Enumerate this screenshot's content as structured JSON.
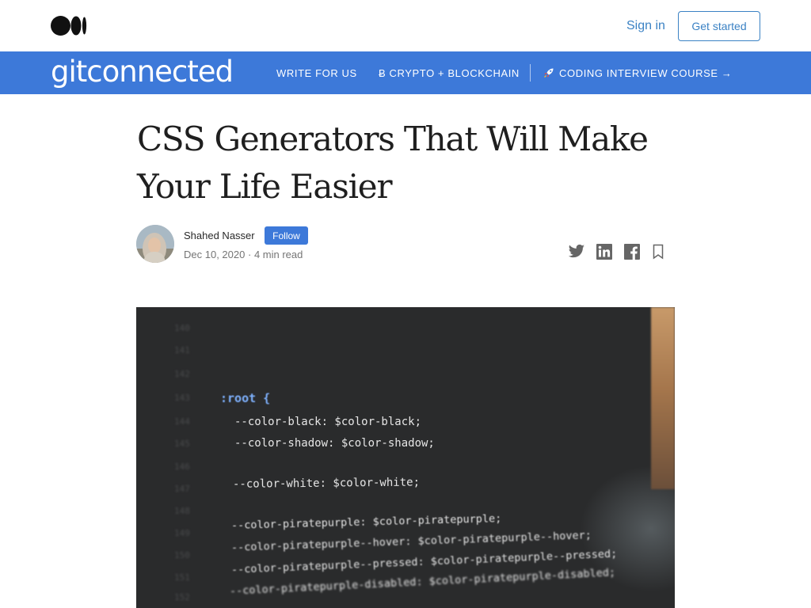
{
  "topbar": {
    "sign_in": "Sign in",
    "get_started": "Get started",
    "logo_icon": "medium-logo-icon"
  },
  "publication": {
    "name": "gitconnected",
    "nav": [
      {
        "label": "WRITE FOR US"
      },
      {
        "label": "Ƀ CRYPTO + BLOCKCHAIN"
      },
      {
        "label": "CODING INTERVIEW COURSE →",
        "icon": "rocket-icon"
      }
    ],
    "color": "#3d79d9"
  },
  "article": {
    "title": "CSS Generators That Will Make Your Life Easier",
    "author": "Shahed Nasser",
    "follow_label": "Follow",
    "date": "Dec 10, 2020",
    "separator": "·",
    "read_time": "4 min read",
    "share_icons": [
      "twitter-icon",
      "linkedin-icon",
      "facebook-icon",
      "bookmark-icon"
    ]
  },
  "hero_code": {
    "line_numbers": [
      "140",
      "141",
      "142",
      "143",
      "144",
      "145",
      "146",
      "147",
      "148",
      "149",
      "150",
      "151",
      "152"
    ],
    "lines": [
      ":root {",
      "--color-black: $color-black;",
      "--color-shadow: $color-shadow;",
      "--color-white: $color-white;",
      "--color-piratepurple: $color-piratepurple;",
      "--color-piratepurple--hover: $color-piratepurple--hover;",
      "--color-piratepurple--pressed: $color-piratepurple--pressed;",
      "--color-piratepurple-disabled: $color-piratepurple-disabled;"
    ]
  }
}
